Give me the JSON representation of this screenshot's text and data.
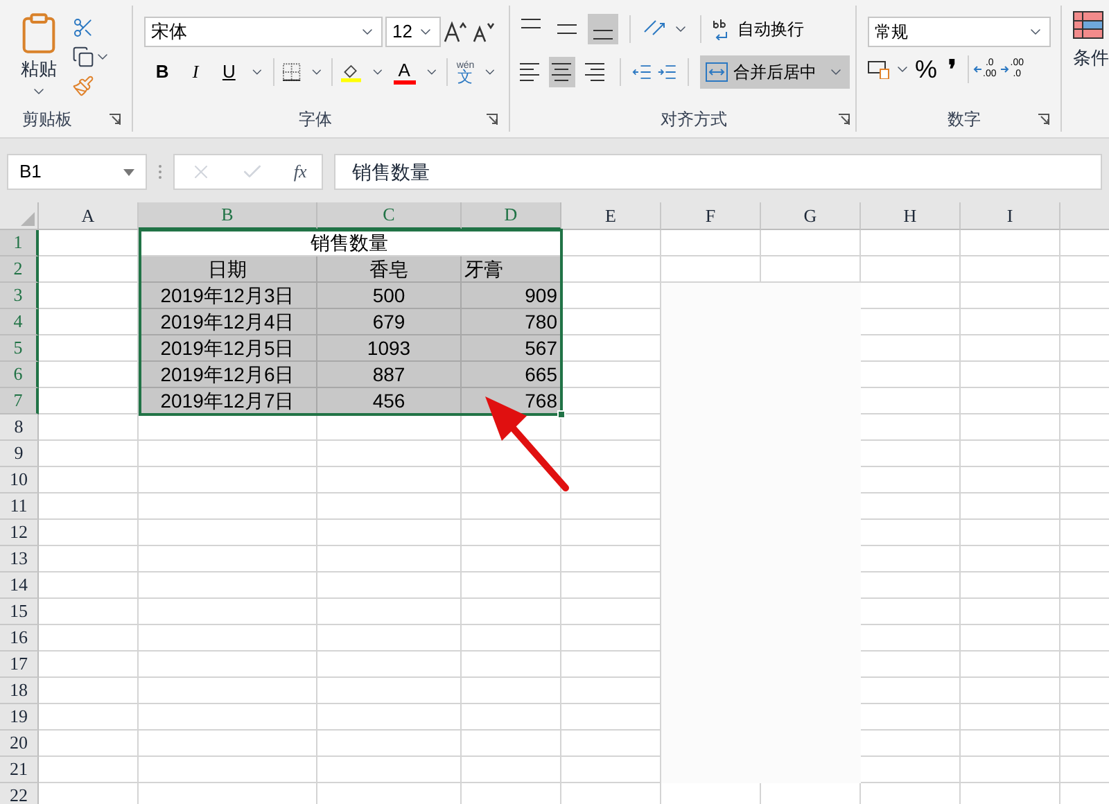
{
  "ribbon": {
    "clipboard": {
      "paste": "粘贴",
      "label": "剪贴板"
    },
    "font": {
      "font_name": "宋体",
      "font_size": "12",
      "bold": "B",
      "italic": "I",
      "underline": "U",
      "font_color": "A",
      "phonetic_top": "wén",
      "phonetic_bottom": "文",
      "label": "字体"
    },
    "alignment": {
      "vertical": [
        {
          "kind": "top",
          "selected": false
        },
        {
          "kind": "middle",
          "selected": false
        },
        {
          "kind": "bottom",
          "selected": true
        }
      ],
      "horizontal": [
        {
          "kind": "left",
          "selected": false
        },
        {
          "kind": "center",
          "selected": true
        },
        {
          "kind": "right",
          "selected": false
        }
      ],
      "wrap_text": "自动换行",
      "merge_center": "合并后居中",
      "merge_selected": true,
      "label": "对齐方式"
    },
    "number": {
      "format": "常规",
      "percent": "%",
      "comma": "❜",
      "decimals_more": [
        ".0",
        ".00"
      ],
      "decimals_less": [
        ".00",
        ".0"
      ],
      "label": "数字"
    },
    "styles": {
      "conditional": "条件"
    }
  },
  "formula_bar": {
    "name_box": "B1",
    "fx": "fx",
    "value": "销售数量"
  },
  "sheet": {
    "columns": [
      {
        "label": "A",
        "selected": false
      },
      {
        "label": "B",
        "selected": true
      },
      {
        "label": "C",
        "selected": true
      },
      {
        "label": "D",
        "selected": true
      },
      {
        "label": "E",
        "selected": false
      },
      {
        "label": "F",
        "selected": false
      },
      {
        "label": "G",
        "selected": false
      },
      {
        "label": "H",
        "selected": false
      },
      {
        "label": "I",
        "selected": false
      }
    ],
    "rows": [
      {
        "label": "1",
        "selected": true
      },
      {
        "label": "2",
        "selected": true
      },
      {
        "label": "3",
        "selected": true
      },
      {
        "label": "4",
        "selected": true
      },
      {
        "label": "5",
        "selected": true
      },
      {
        "label": "6",
        "selected": true
      },
      {
        "label": "7",
        "selected": true
      },
      {
        "label": "8",
        "selected": false
      },
      {
        "label": "9",
        "selected": false
      },
      {
        "label": "10",
        "selected": false
      },
      {
        "label": "11",
        "selected": false
      },
      {
        "label": "12",
        "selected": false
      },
      {
        "label": "13",
        "selected": false
      },
      {
        "label": "14",
        "selected": false
      },
      {
        "label": "15",
        "selected": false
      },
      {
        "label": "16",
        "selected": false
      },
      {
        "label": "17",
        "selected": false
      },
      {
        "label": "18",
        "selected": false
      },
      {
        "label": "19",
        "selected": false
      },
      {
        "label": "20",
        "selected": false
      },
      {
        "label": "21",
        "selected": false
      },
      {
        "label": "22",
        "selected": false
      }
    ],
    "title": "销售数量",
    "header": [
      "日期",
      "香皂",
      "牙膏"
    ],
    "data": [
      [
        "2019年12月3日",
        "500",
        "909"
      ],
      [
        "2019年12月4日",
        "679",
        "780"
      ],
      [
        "2019年12月5日",
        "1093",
        "567"
      ],
      [
        "2019年12月6日",
        "887",
        "665"
      ],
      [
        "2019年12月7日",
        "456",
        "768"
      ]
    ]
  }
}
